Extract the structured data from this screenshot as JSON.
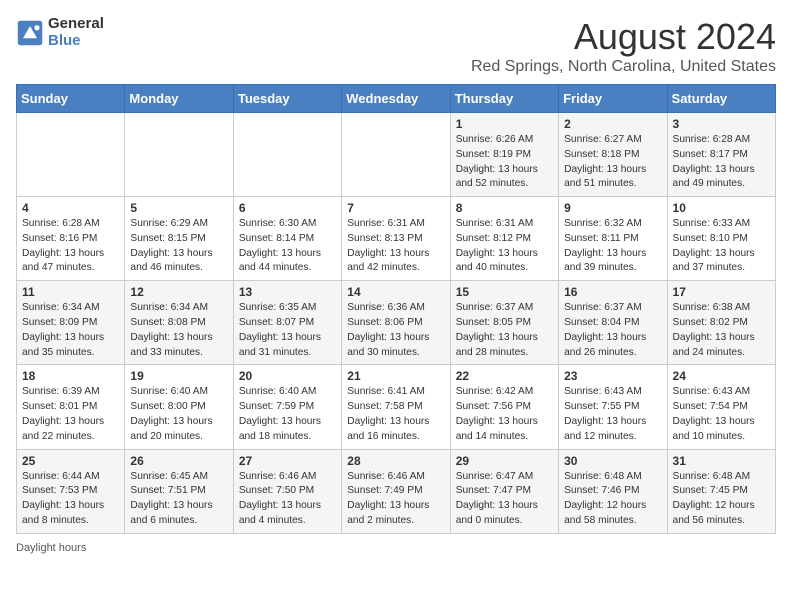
{
  "header": {
    "logo_general": "General",
    "logo_blue": "Blue",
    "month_year": "August 2024",
    "location": "Red Springs, North Carolina, United States"
  },
  "days_of_week": [
    "Sunday",
    "Monday",
    "Tuesday",
    "Wednesday",
    "Thursday",
    "Friday",
    "Saturday"
  ],
  "weeks": [
    [
      {
        "day": "",
        "content": ""
      },
      {
        "day": "",
        "content": ""
      },
      {
        "day": "",
        "content": ""
      },
      {
        "day": "",
        "content": ""
      },
      {
        "day": "1",
        "content": "Sunrise: 6:26 AM\nSunset: 8:19 PM\nDaylight: 13 hours\nand 52 minutes."
      },
      {
        "day": "2",
        "content": "Sunrise: 6:27 AM\nSunset: 8:18 PM\nDaylight: 13 hours\nand 51 minutes."
      },
      {
        "day": "3",
        "content": "Sunrise: 6:28 AM\nSunset: 8:17 PM\nDaylight: 13 hours\nand 49 minutes."
      }
    ],
    [
      {
        "day": "4",
        "content": "Sunrise: 6:28 AM\nSunset: 8:16 PM\nDaylight: 13 hours\nand 47 minutes."
      },
      {
        "day": "5",
        "content": "Sunrise: 6:29 AM\nSunset: 8:15 PM\nDaylight: 13 hours\nand 46 minutes."
      },
      {
        "day": "6",
        "content": "Sunrise: 6:30 AM\nSunset: 8:14 PM\nDaylight: 13 hours\nand 44 minutes."
      },
      {
        "day": "7",
        "content": "Sunrise: 6:31 AM\nSunset: 8:13 PM\nDaylight: 13 hours\nand 42 minutes."
      },
      {
        "day": "8",
        "content": "Sunrise: 6:31 AM\nSunset: 8:12 PM\nDaylight: 13 hours\nand 40 minutes."
      },
      {
        "day": "9",
        "content": "Sunrise: 6:32 AM\nSunset: 8:11 PM\nDaylight: 13 hours\nand 39 minutes."
      },
      {
        "day": "10",
        "content": "Sunrise: 6:33 AM\nSunset: 8:10 PM\nDaylight: 13 hours\nand 37 minutes."
      }
    ],
    [
      {
        "day": "11",
        "content": "Sunrise: 6:34 AM\nSunset: 8:09 PM\nDaylight: 13 hours\nand 35 minutes."
      },
      {
        "day": "12",
        "content": "Sunrise: 6:34 AM\nSunset: 8:08 PM\nDaylight: 13 hours\nand 33 minutes."
      },
      {
        "day": "13",
        "content": "Sunrise: 6:35 AM\nSunset: 8:07 PM\nDaylight: 13 hours\nand 31 minutes."
      },
      {
        "day": "14",
        "content": "Sunrise: 6:36 AM\nSunset: 8:06 PM\nDaylight: 13 hours\nand 30 minutes."
      },
      {
        "day": "15",
        "content": "Sunrise: 6:37 AM\nSunset: 8:05 PM\nDaylight: 13 hours\nand 28 minutes."
      },
      {
        "day": "16",
        "content": "Sunrise: 6:37 AM\nSunset: 8:04 PM\nDaylight: 13 hours\nand 26 minutes."
      },
      {
        "day": "17",
        "content": "Sunrise: 6:38 AM\nSunset: 8:02 PM\nDaylight: 13 hours\nand 24 minutes."
      }
    ],
    [
      {
        "day": "18",
        "content": "Sunrise: 6:39 AM\nSunset: 8:01 PM\nDaylight: 13 hours\nand 22 minutes."
      },
      {
        "day": "19",
        "content": "Sunrise: 6:40 AM\nSunset: 8:00 PM\nDaylight: 13 hours\nand 20 minutes."
      },
      {
        "day": "20",
        "content": "Sunrise: 6:40 AM\nSunset: 7:59 PM\nDaylight: 13 hours\nand 18 minutes."
      },
      {
        "day": "21",
        "content": "Sunrise: 6:41 AM\nSunset: 7:58 PM\nDaylight: 13 hours\nand 16 minutes."
      },
      {
        "day": "22",
        "content": "Sunrise: 6:42 AM\nSunset: 7:56 PM\nDaylight: 13 hours\nand 14 minutes."
      },
      {
        "day": "23",
        "content": "Sunrise: 6:43 AM\nSunset: 7:55 PM\nDaylight: 13 hours\nand 12 minutes."
      },
      {
        "day": "24",
        "content": "Sunrise: 6:43 AM\nSunset: 7:54 PM\nDaylight: 13 hours\nand 10 minutes."
      }
    ],
    [
      {
        "day": "25",
        "content": "Sunrise: 6:44 AM\nSunset: 7:53 PM\nDaylight: 13 hours\nand 8 minutes."
      },
      {
        "day": "26",
        "content": "Sunrise: 6:45 AM\nSunset: 7:51 PM\nDaylight: 13 hours\nand 6 minutes."
      },
      {
        "day": "27",
        "content": "Sunrise: 6:46 AM\nSunset: 7:50 PM\nDaylight: 13 hours\nand 4 minutes."
      },
      {
        "day": "28",
        "content": "Sunrise: 6:46 AM\nSunset: 7:49 PM\nDaylight: 13 hours\nand 2 minutes."
      },
      {
        "day": "29",
        "content": "Sunrise: 6:47 AM\nSunset: 7:47 PM\nDaylight: 13 hours\nand 0 minutes."
      },
      {
        "day": "30",
        "content": "Sunrise: 6:48 AM\nSunset: 7:46 PM\nDaylight: 12 hours\nand 58 minutes."
      },
      {
        "day": "31",
        "content": "Sunrise: 6:48 AM\nSunset: 7:45 PM\nDaylight: 12 hours\nand 56 minutes."
      }
    ]
  ],
  "footer": "Daylight hours"
}
